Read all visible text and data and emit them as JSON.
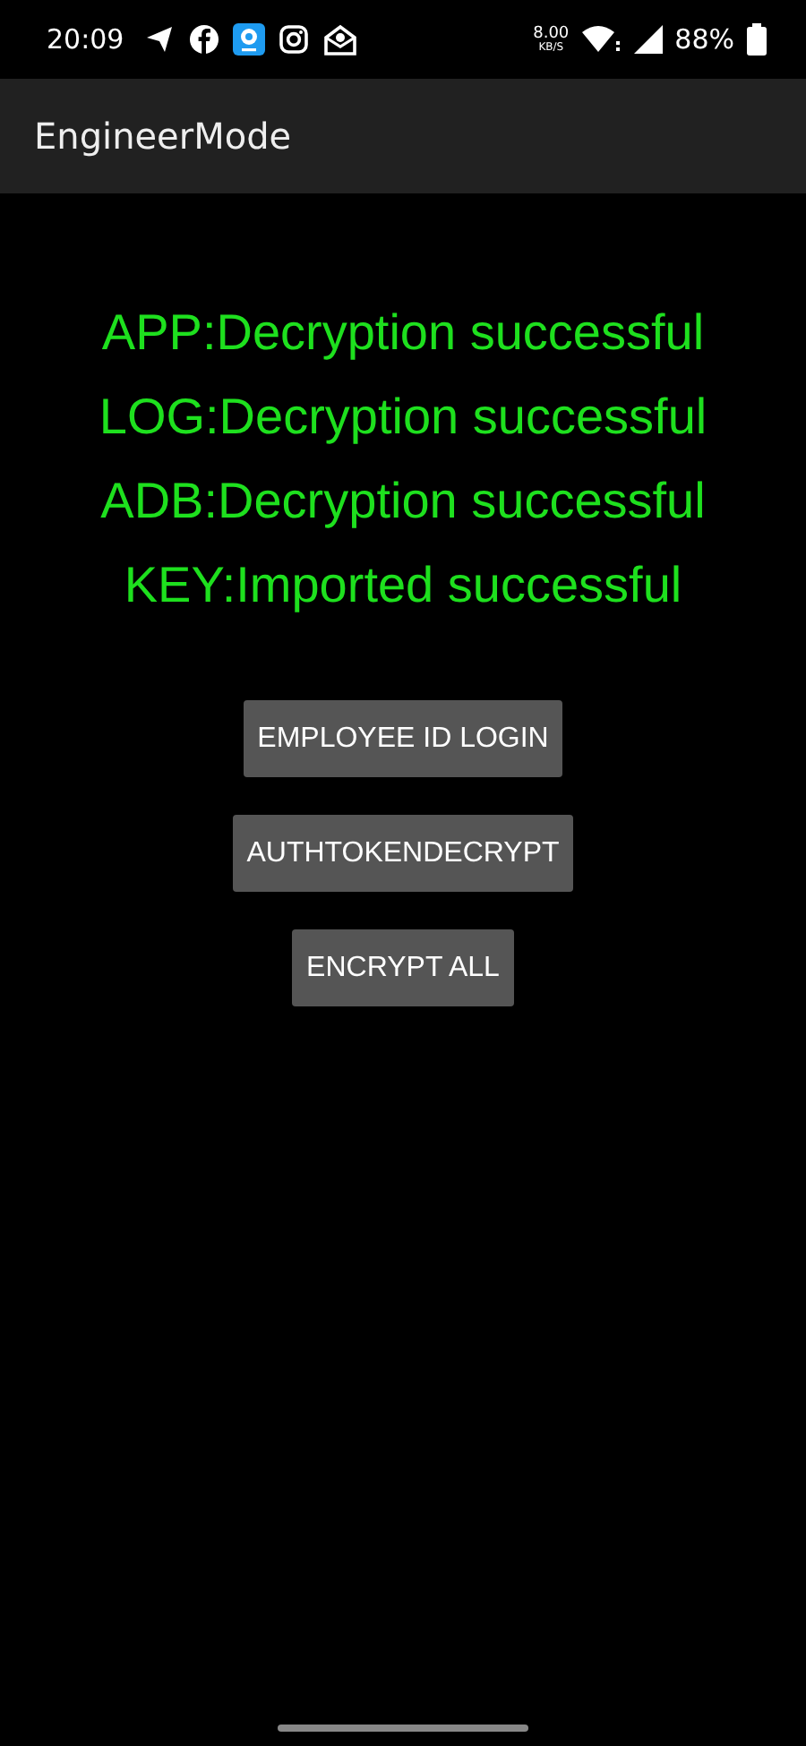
{
  "status_bar": {
    "time": "20:09",
    "speed_value": "8.00",
    "speed_unit": "KB/S",
    "battery": "88%"
  },
  "app_bar": {
    "title": "EngineerMode"
  },
  "messages": [
    "APP:Decryption successful",
    "LOG:Decryption successful",
    "ADB:Decryption successful",
    "KEY:Imported successful"
  ],
  "buttons": [
    "EMPLOYEE ID LOGIN",
    "AUTHTOKENDECRYPT",
    "ENCRYPT ALL"
  ]
}
